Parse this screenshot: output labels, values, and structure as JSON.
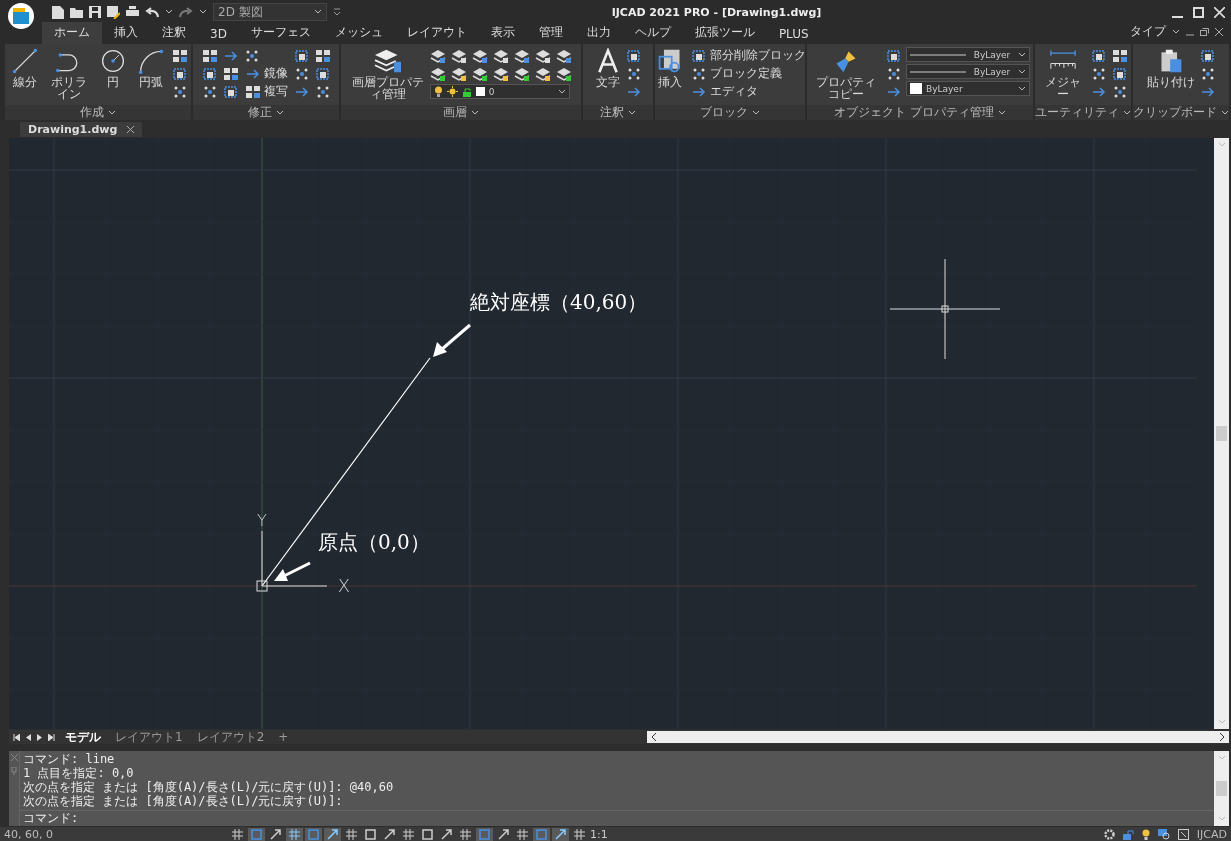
{
  "title_bar": {
    "workspace": "2D 製図",
    "title": "IJCAD 2021 PRO - [Drawing1.dwg]"
  },
  "ribbon_tabs": [
    {
      "label": "ホーム",
      "selected": true
    },
    {
      "label": "挿入",
      "selected": false
    },
    {
      "label": "注釈",
      "selected": false
    },
    {
      "label": "3D",
      "selected": false
    },
    {
      "label": "サーフェス",
      "selected": false
    },
    {
      "label": "メッシュ",
      "selected": false
    },
    {
      "label": "レイアウト",
      "selected": false
    },
    {
      "label": "表示",
      "selected": false
    },
    {
      "label": "管理",
      "selected": false
    },
    {
      "label": "出力",
      "selected": false
    },
    {
      "label": "ヘルプ",
      "selected": false
    },
    {
      "label": "拡張ツール",
      "selected": false
    },
    {
      "label": "PLUS",
      "selected": false
    }
  ],
  "type_menu": "タイプ",
  "ribbon_panels": [
    {
      "title": "作成",
      "tools": [
        {
          "kind": "line",
          "label": "線分"
        },
        {
          "kind": "polyline",
          "label": "ポリライン"
        },
        {
          "kind": "circle",
          "label": "円"
        },
        {
          "kind": "arc",
          "label": "円弧"
        },
        {
          "kind": "small"
        },
        {
          "kind": "small"
        },
        {
          "kind": "small"
        }
      ]
    },
    {
      "title": "修正",
      "tools": [
        {
          "kind": "small"
        },
        {
          "kind": "small"
        },
        {
          "kind": "small"
        },
        {
          "kind": "small"
        },
        {
          "kind": "small"
        },
        {
          "kind": "small"
        },
        {
          "kind": "small"
        },
        {
          "kind": "small",
          "label": "鏡像"
        },
        {
          "kind": "small",
          "label": "複写"
        },
        {
          "kind": "small"
        },
        {
          "kind": "small"
        },
        {
          "kind": "small"
        },
        {
          "kind": "small"
        },
        {
          "kind": "small"
        },
        {
          "kind": "small"
        }
      ]
    },
    {
      "title": "画層",
      "tools": [
        {
          "kind": "layers",
          "label": "画層プロパティ管理"
        },
        {
          "kind": "small"
        },
        {
          "kind": "small"
        },
        {
          "kind": "small"
        },
        {
          "kind": "small"
        },
        {
          "kind": "small"
        },
        {
          "kind": "small"
        },
        {
          "kind": "small"
        },
        {
          "kind": "small"
        },
        {
          "kind": "small"
        },
        {
          "kind": "small"
        },
        {
          "kind": "small"
        },
        {
          "kind": "small"
        },
        {
          "kind": "small"
        },
        {
          "kind": "small"
        },
        {
          "kind": "layer-dropdown",
          "value": "0"
        }
      ]
    },
    {
      "title": "注釈",
      "tools": [
        {
          "kind": "text",
          "label": "文字"
        },
        {
          "kind": "small"
        },
        {
          "kind": "small"
        },
        {
          "kind": "small"
        }
      ]
    },
    {
      "title": "ブロック",
      "tools": [
        {
          "kind": "insert",
          "label": "挿入"
        },
        {
          "kind": "small",
          "label": "部分削除ブロック"
        },
        {
          "kind": "small",
          "label": "ブロック定義"
        },
        {
          "kind": "small",
          "label": "エディタ"
        }
      ]
    },
    {
      "title": "オブジェクト プロパティ管理",
      "tools": [
        {
          "kind": "brush",
          "label": "プロパティコピー"
        },
        {
          "kind": "small"
        },
        {
          "kind": "small"
        },
        {
          "kind": "small"
        },
        {
          "kind": "line-dropdown",
          "value": "ByLayer"
        },
        {
          "kind": "line-dropdown",
          "value": "ByLayer"
        },
        {
          "kind": "color-dropdown",
          "value": "ByLayer"
        }
      ]
    },
    {
      "title": "ユーティリティ",
      "tools": [
        {
          "kind": "measure",
          "label": "メジャー"
        },
        {
          "kind": "small"
        },
        {
          "kind": "small"
        },
        {
          "kind": "small"
        },
        {
          "kind": "small"
        },
        {
          "kind": "small"
        },
        {
          "kind": "small"
        }
      ]
    },
    {
      "title": "クリップボード",
      "tools": [
        {
          "kind": "paste",
          "label": "貼り付け"
        },
        {
          "kind": "small"
        },
        {
          "kind": "small"
        },
        {
          "kind": "small"
        }
      ]
    }
  ],
  "document_tab": {
    "label": "Drawing1.dwg"
  },
  "canvas": {
    "annotations": [
      {
        "text": "絶対座標（40,60）"
      },
      {
        "text": "原点（0,0）"
      }
    ],
    "axis_labels": [
      "Y",
      "X"
    ]
  },
  "layout_tabs": [
    {
      "label": "モデル",
      "selected": true
    },
    {
      "label": "レイアウト1",
      "selected": false
    },
    {
      "label": "レイアウト2",
      "selected": false
    },
    {
      "label": "+",
      "selected": false
    }
  ],
  "command": {
    "history": [
      "コマンド: line",
      "1 点目を指定:  0,0",
      "次の点を指定 または [角度(A)/長さ(L)/元に戻す(U)]: @40,60",
      "次の点を指定 または [角度(A)/長さ(L)/元に戻す(U)]:"
    ],
    "prompt": "コマンド:"
  },
  "status_bar": {
    "coordinates": "40, 60, 0",
    "scale": "1:1",
    "brand": "IJCAD",
    "toggles": [
      {
        "on": false
      },
      {
        "on": true
      },
      {
        "on": false
      },
      {
        "on": true
      },
      {
        "on": true
      },
      {
        "on": true
      },
      {
        "on": false
      },
      {
        "on": false
      },
      {
        "on": false
      },
      {
        "on": false
      },
      {
        "on": false
      },
      {
        "on": false
      },
      {
        "on": false
      },
      {
        "on": true
      },
      {
        "on": false
      },
      {
        "on": false
      },
      {
        "on": true
      },
      {
        "on": true
      },
      {
        "on": false
      }
    ]
  }
}
